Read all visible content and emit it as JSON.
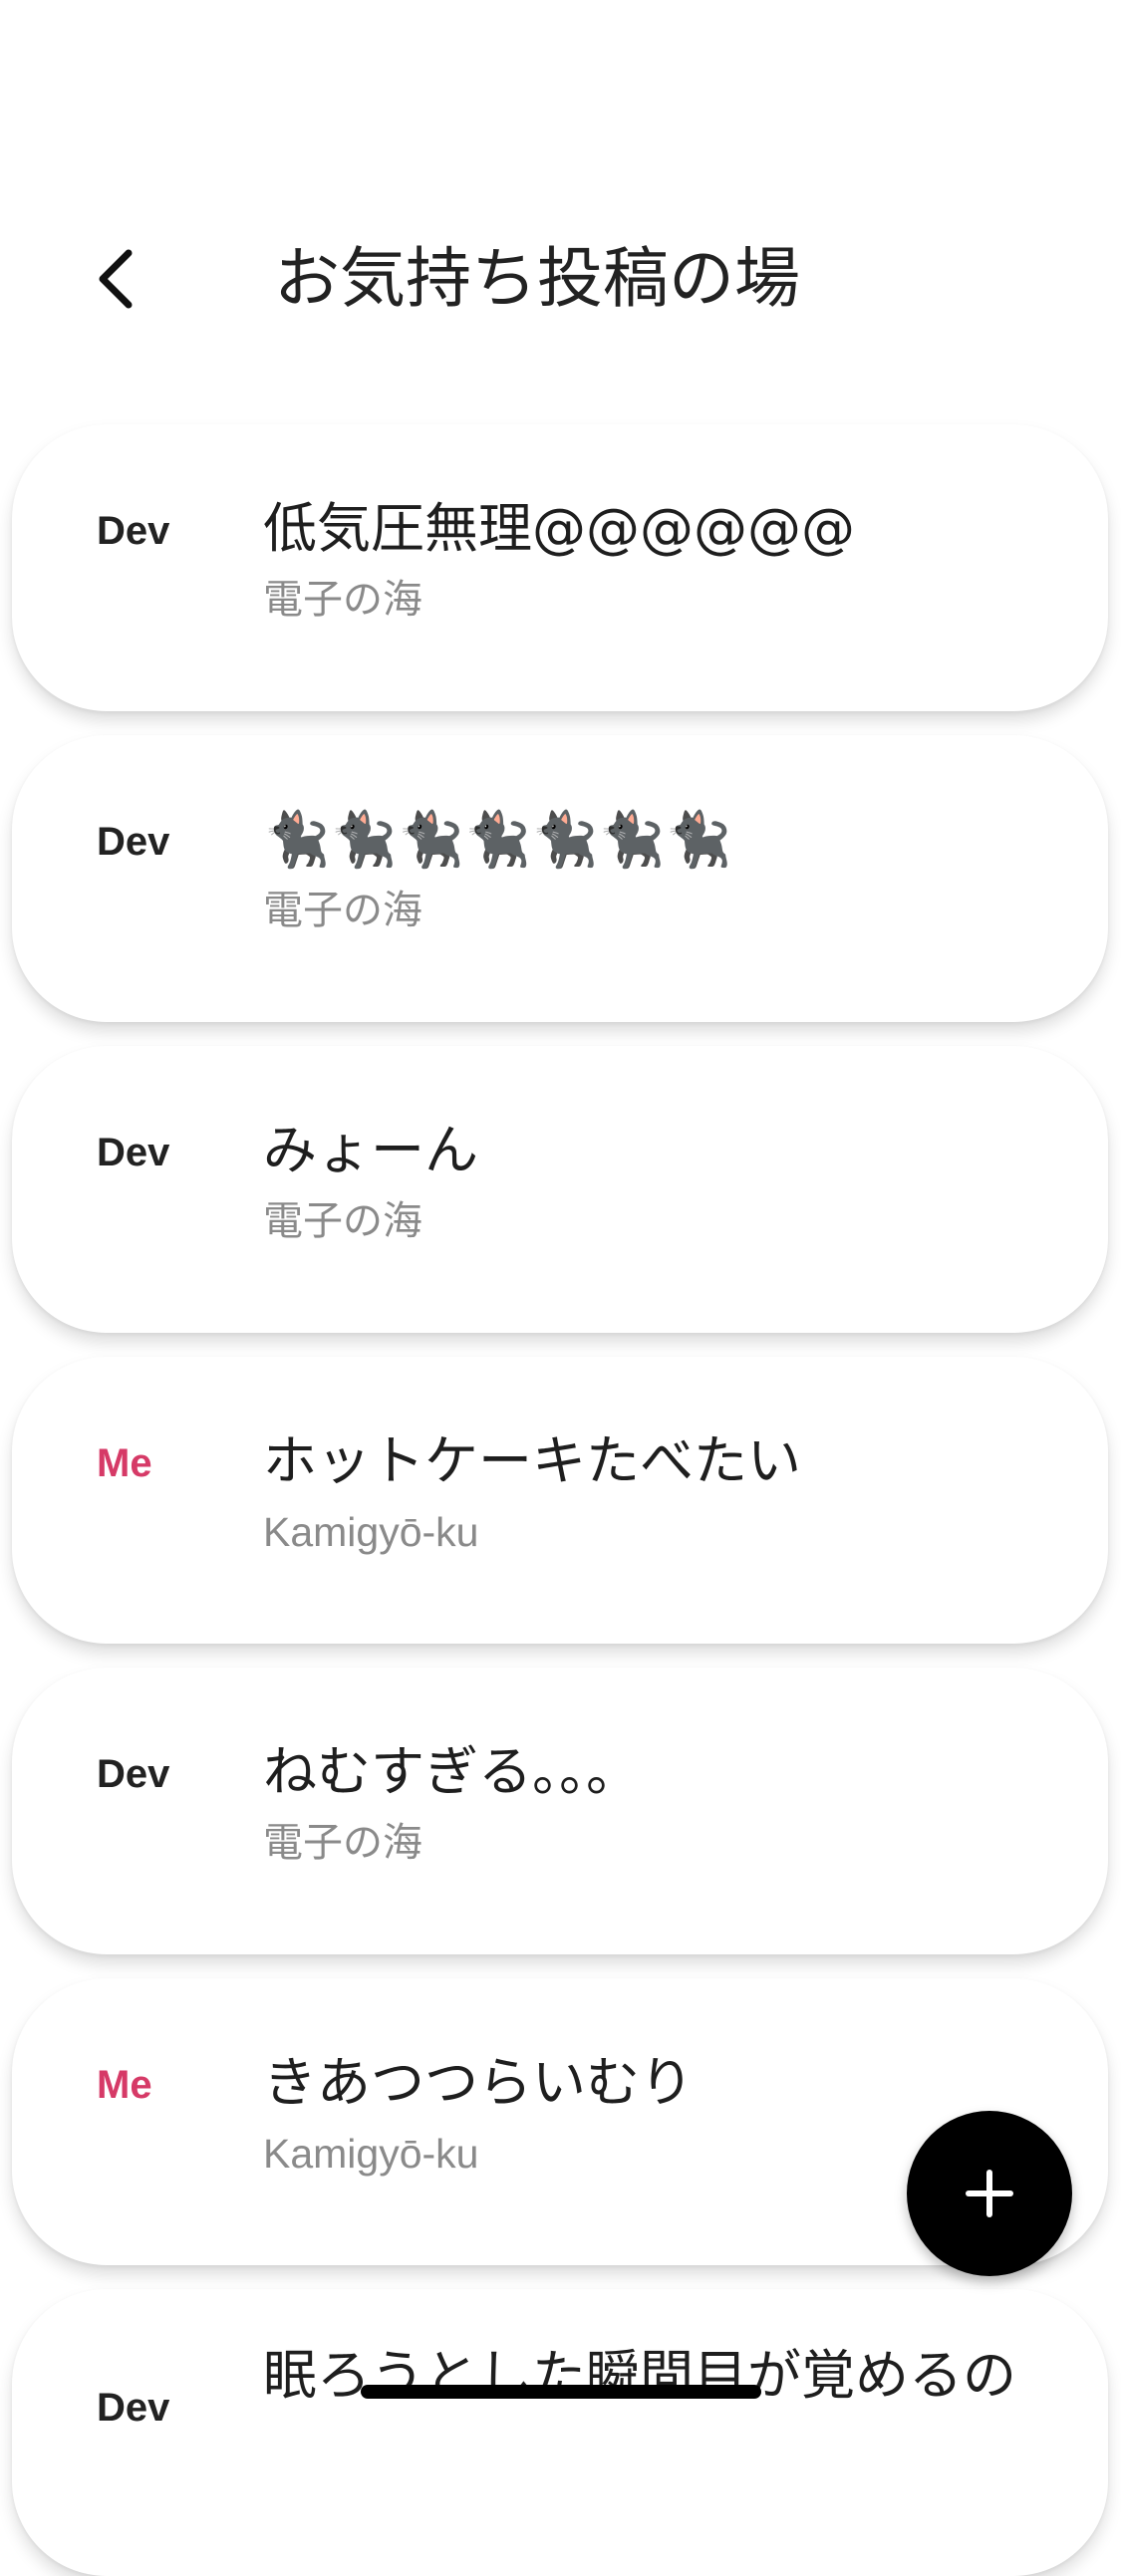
{
  "header": {
    "title": "お気持ち投稿の場",
    "back_icon": "chevron-left-icon"
  },
  "posts": [
    {
      "author": "Dev",
      "message": "低気圧無理@@@@@@",
      "location": "電子の海",
      "is_me": false
    },
    {
      "author": "Dev",
      "message": "🐈‍⬛🐈‍⬛🐈‍⬛🐈‍⬛🐈‍⬛🐈‍⬛🐈‍⬛",
      "location": "電子の海",
      "is_me": false
    },
    {
      "author": "Dev",
      "message": "みょーん",
      "location": "電子の海",
      "is_me": false
    },
    {
      "author": "Me",
      "message": "ホットケーキたべたい",
      "location": "Kamigyō-ku",
      "is_me": true
    },
    {
      "author": "Dev",
      "message": "ねむすぎる。。。",
      "location": "電子の海",
      "is_me": false
    },
    {
      "author": "Me",
      "message": "きあつつらいむり",
      "location": "Kamigyō-ku",
      "is_me": true
    },
    {
      "author": "Dev",
      "message": "眠ろうとした瞬間目が覚めるの",
      "location": "",
      "is_me": false
    }
  ],
  "fab": {
    "icon": "plus-icon"
  },
  "colors": {
    "me_accent": "#d63a67",
    "fab_bg": "#000000",
    "location_text": "#8a8a8a"
  }
}
